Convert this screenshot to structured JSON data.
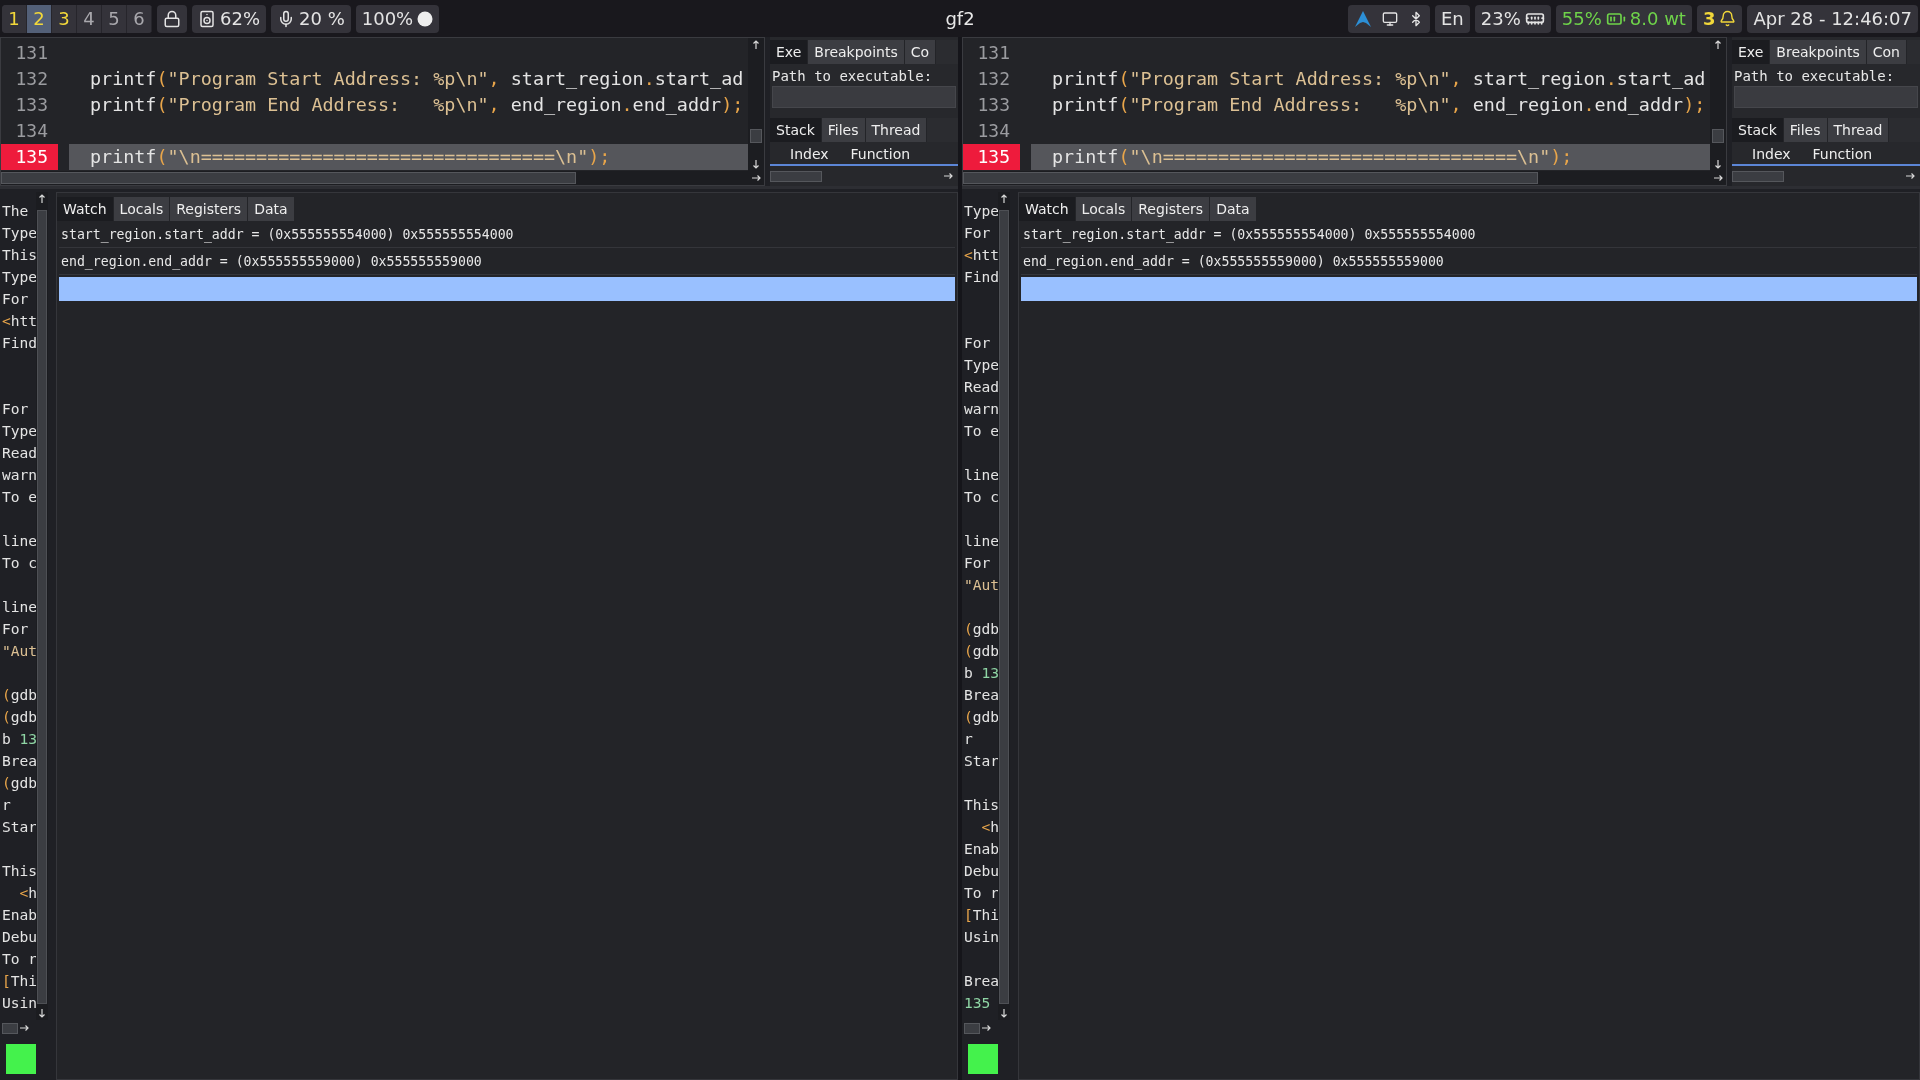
{
  "top_bar": {
    "workspaces": [
      {
        "label": "1",
        "occupied": true,
        "selected": false
      },
      {
        "label": "2",
        "occupied": true,
        "selected": true
      },
      {
        "label": "3",
        "occupied": true,
        "selected": false
      },
      {
        "label": "4",
        "occupied": false,
        "selected": false
      },
      {
        "label": "5",
        "occupied": false,
        "selected": false
      },
      {
        "label": "6",
        "occupied": false,
        "selected": false
      }
    ],
    "left_widgets": [
      {
        "kind": "lock"
      },
      {
        "kind": "volume",
        "text": "62%"
      },
      {
        "kind": "mic",
        "text": "20 %"
      },
      {
        "kind": "brightness",
        "text": "100%"
      }
    ],
    "title": "gf2",
    "right_widgets": [
      {
        "kind": "tray"
      },
      {
        "kind": "language",
        "text": "En"
      },
      {
        "kind": "memory",
        "text": "23%"
      },
      {
        "kind": "battery",
        "text": "55%",
        "power": "8.0 wt"
      },
      {
        "kind": "notifications",
        "text": "3"
      },
      {
        "kind": "clock",
        "text": "Apr 28 - 12:46:07"
      }
    ]
  },
  "panes": [
    {
      "code_lines": [
        {
          "number": "131",
          "breakpoint": false,
          "current": false
        },
        {
          "number": "132",
          "breakpoint": false,
          "current": false,
          "tokens": [
            {
              "text": "printf"
            },
            {
              "text": "(",
              "kind": "punct"
            },
            {
              "text": "\"Program Start Address: %p\\n\"",
              "kind": "string"
            },
            {
              "text": ",",
              "kind": "punct"
            },
            {
              "text": " start_region"
            },
            {
              "text": ".",
              "kind": "punct"
            },
            {
              "text": "start_ad"
            }
          ]
        },
        {
          "number": "133",
          "breakpoint": false,
          "current": false,
          "tokens": [
            {
              "text": "printf"
            },
            {
              "text": "(",
              "kind": "punct"
            },
            {
              "text": "\"Program End Address:   %p\\n\"",
              "kind": "string"
            },
            {
              "text": ",",
              "kind": "punct"
            },
            {
              "text": " end_region"
            },
            {
              "text": ".",
              "kind": "punct"
            },
            {
              "text": "end_addr"
            },
            {
              "text": ");",
              "kind": "punct"
            }
          ]
        },
        {
          "number": "134",
          "breakpoint": false,
          "current": false
        },
        {
          "number": "135",
          "breakpoint": true,
          "current": true,
          "tokens": [
            {
              "text": "printf"
            },
            {
              "text": "(",
              "kind": "punct"
            },
            {
              "text": "\"\\n================================\\n\"",
              "kind": "string"
            },
            {
              "text": ");",
              "kind": "punct"
            }
          ]
        }
      ],
      "exe_tabs": [
        {
          "label": "Exe",
          "selected": true
        },
        {
          "label": "Breakpoints",
          "selected": false
        },
        {
          "label": "Co",
          "selected": false
        }
      ],
      "path_label": "Path to executable:",
      "stack_tabs": [
        {
          "label": "Stack",
          "selected": true
        },
        {
          "label": "Files",
          "selected": false
        },
        {
          "label": "Thread",
          "selected": false
        }
      ],
      "stack_columns": [
        "Index",
        "Function"
      ],
      "console_blocks": [
        {
          "kind": "double_gap",
          "lines": [
            "The",
            "Type",
            "This",
            "Type",
            "For",
            [
              {
                "text": "<",
                "kind": "punct"
              },
              {
                "text": "htt"
              }
            ],
            "Find"
          ]
        },
        {
          "kind": "single_gap",
          "lines": [
            "For",
            "Type",
            "Read",
            "warn",
            "To e"
          ]
        },
        {
          "kind": "single_gap",
          "lines": [
            "line",
            "To c"
          ]
        },
        {
          "kind": "single_gap",
          "lines": [
            "line",
            "For",
            [
              {
                "text": "\"Aut",
                "kind": "string"
              }
            ]
          ]
        },
        {
          "kind": "single_gap",
          "lines": [
            [
              {
                "text": "(",
                "kind": "punct"
              },
              {
                "text": "gdb"
              }
            ],
            [
              {
                "text": "(",
                "kind": "punct"
              },
              {
                "text": "gdb"
              }
            ],
            [
              {
                "text": "b "
              },
              {
                "text": "13",
                "kind": "number"
              }
            ],
            "Brea",
            [
              {
                "text": "(",
                "kind": "punct"
              },
              {
                "text": "gdb"
              }
            ],
            "r",
            "Star"
          ]
        },
        {
          "kind": "last",
          "lines": [
            "This",
            [
              {
                "text": "  <",
                "kind": "punct"
              },
              {
                "text": "h"
              }
            ],
            "Enab",
            "Debu",
            "To r",
            [
              {
                "text": "[",
                "kind": "punct"
              },
              {
                "text": "Thi"
              }
            ],
            "Usin"
          ]
        }
      ],
      "watch_tabs": [
        {
          "label": "Watch",
          "selected": true
        },
        {
          "label": "Locals",
          "selected": false
        },
        {
          "label": "Registers",
          "selected": false
        },
        {
          "label": "Data",
          "selected": false
        }
      ],
      "watch_rows": [
        "start_region.start_addr = (0x555555554000) 0x555555554000",
        "end_region.end_addr = (0x555555559000) 0x555555559000"
      ],
      "new_watch_row": {
        "selected": true
      }
    },
    {
      "code_lines": [
        {
          "number": "131",
          "breakpoint": false,
          "current": false
        },
        {
          "number": "132",
          "breakpoint": false,
          "current": false,
          "tokens": [
            {
              "text": "printf"
            },
            {
              "text": "(",
              "kind": "punct"
            },
            {
              "text": "\"Program Start Address: %p\\n\"",
              "kind": "string"
            },
            {
              "text": ",",
              "kind": "punct"
            },
            {
              "text": " start_region"
            },
            {
              "text": ".",
              "kind": "punct"
            },
            {
              "text": "start_ad"
            }
          ]
        },
        {
          "number": "133",
          "breakpoint": false,
          "current": false,
          "tokens": [
            {
              "text": "printf"
            },
            {
              "text": "(",
              "kind": "punct"
            },
            {
              "text": "\"Program End Address:   %p\\n\"",
              "kind": "string"
            },
            {
              "text": ",",
              "kind": "punct"
            },
            {
              "text": " end_region"
            },
            {
              "text": ".",
              "kind": "punct"
            },
            {
              "text": "end_addr"
            },
            {
              "text": ");",
              "kind": "punct"
            }
          ]
        },
        {
          "number": "134",
          "breakpoint": false,
          "current": false
        },
        {
          "number": "135",
          "breakpoint": true,
          "current": true,
          "tokens": [
            {
              "text": "printf"
            },
            {
              "text": "(",
              "kind": "punct"
            },
            {
              "text": "\"\\n================================\\n\"",
              "kind": "string"
            },
            {
              "text": ");",
              "kind": "punct"
            }
          ]
        }
      ],
      "exe_tabs": [
        {
          "label": "Exe",
          "selected": true
        },
        {
          "label": "Breakpoints",
          "selected": false
        },
        {
          "label": "Con",
          "selected": false
        }
      ],
      "path_label": "Path to executable:",
      "stack_tabs": [
        {
          "label": "Stack",
          "selected": true
        },
        {
          "label": "Files",
          "selected": false
        },
        {
          "label": "Thread",
          "selected": false
        }
      ],
      "stack_columns": [
        "Index",
        "Function"
      ],
      "console_blocks": [
        {
          "kind": "double_gap",
          "lines": [
            "Type",
            "For",
            [
              {
                "text": "<",
                "kind": "punct"
              },
              {
                "text": "htt"
              }
            ],
            "Find"
          ]
        },
        {
          "kind": "single_gap",
          "lines": [
            "For",
            "Type",
            "Read",
            "warn",
            "To e"
          ]
        },
        {
          "kind": "single_gap",
          "lines": [
            "line",
            "To c"
          ]
        },
        {
          "kind": "single_gap",
          "lines": [
            "line",
            "For",
            [
              {
                "text": "\"Aut",
                "kind": "string"
              }
            ]
          ]
        },
        {
          "kind": "single_gap",
          "lines": [
            [
              {
                "text": "(",
                "kind": "punct"
              },
              {
                "text": "gdb"
              }
            ],
            [
              {
                "text": "(",
                "kind": "punct"
              },
              {
                "text": "gdb"
              }
            ],
            [
              {
                "text": "b "
              },
              {
                "text": "13",
                "kind": "number"
              }
            ],
            "Brea",
            [
              {
                "text": "(",
                "kind": "punct"
              },
              {
                "text": "gdb"
              }
            ],
            "r",
            "Star"
          ]
        },
        {
          "kind": "single_gap",
          "lines": [
            "This",
            [
              {
                "text": "  <",
                "kind": "punct"
              },
              {
                "text": "h"
              }
            ],
            "Enab",
            "Debu",
            "To r",
            [
              {
                "text": "[",
                "kind": "punct"
              },
              {
                "text": "Thi"
              }
            ],
            "Usin"
          ]
        },
        {
          "kind": "last",
          "lines": [
            "Brea",
            [
              {
                "text": "135",
                "kind": "number"
              }
            ]
          ]
        }
      ],
      "watch_tabs": [
        {
          "label": "Watch",
          "selected": true
        },
        {
          "label": "Locals",
          "selected": false
        },
        {
          "label": "Registers",
          "selected": false
        },
        {
          "label": "Data",
          "selected": false
        }
      ],
      "watch_rows": [
        "start_region.start_addr = (0x555555554000) 0x555555554000",
        "end_region.end_addr = (0x555555559000) 0x555555559000"
      ],
      "new_watch_row": {
        "selected": true
      }
    }
  ]
}
